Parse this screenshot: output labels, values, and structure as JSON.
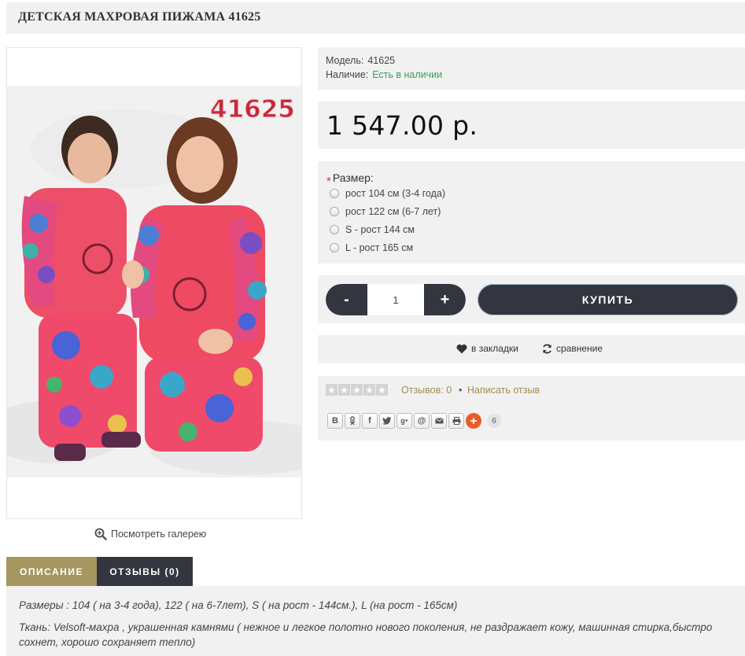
{
  "product": {
    "title": "ДЕТСКАЯ МАХРОВАЯ ПИЖАМА 41625",
    "image_alt": "41625",
    "gallery_link": "Посмотреть галерею"
  },
  "info": {
    "model_label": "Модель:",
    "model_value": "41625",
    "stock_label": "Наличие:",
    "stock_value": "Есть в наличии"
  },
  "price": "1 547.00 р.",
  "options": {
    "title": "Размер:",
    "required_mark": "*",
    "items": [
      "рост 104 см (3-4 года)",
      "рост 122 см (6-7 лет)",
      "S - рост 144 см",
      "L - рост 165 см"
    ]
  },
  "cart": {
    "minus": "-",
    "quantity": "1",
    "plus": "+",
    "buy": "КУПИТЬ"
  },
  "actions": {
    "wishlist": "в закладки",
    "compare": "сравнение"
  },
  "reviews": {
    "rating": 0,
    "count_text": "Отзывов: 0",
    "separator": "•",
    "write": "Написать отзыв"
  },
  "share": {
    "buttons": [
      "В",
      "ok",
      "f",
      "tw",
      "g+",
      "@",
      "mail",
      "print"
    ],
    "count": "6"
  },
  "tabs": [
    {
      "label": "ОПИСАНИЕ",
      "active": true
    },
    {
      "label": "ОТЗЫВЫ (0)",
      "active": false
    }
  ],
  "description": [
    "Размеры : 104 ( на 3-4 года), 122 ( на 6-7лет), S ( на рост - 144см.), L (на рост - 165см)",
    "Ткань: Velsoft-махра , украшенная камнями ( нежное и легкое полотно нового поколения, не раздражает кожу, машинная стирка,быстро сохнет, хорошо сохраняет тепло)"
  ],
  "colors": {
    "accent": "#a69660",
    "dark_button": "#33353f",
    "in_stock": "#3a9c5a",
    "panel_bg": "#f1f1f1"
  }
}
